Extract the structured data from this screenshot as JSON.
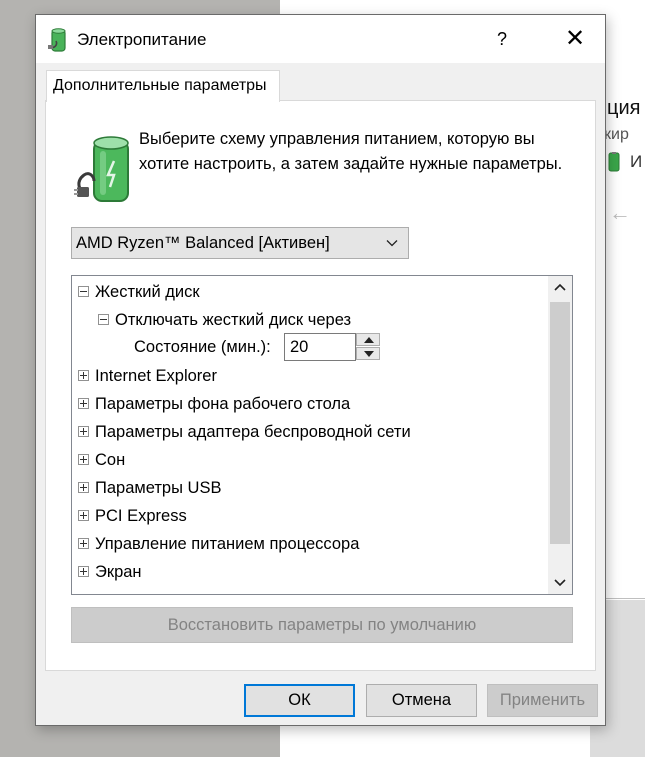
{
  "window": {
    "title": "Электропитание",
    "help_label": "?",
    "close_label": "✕"
  },
  "tab": {
    "label": "Дополнительные параметры"
  },
  "description": "Выберите схему управления питанием, которую вы хотите настроить, а затем задайте нужные параметры.",
  "plan_select": {
    "value": "AMD Ryzen™ Balanced [Активен]"
  },
  "tree": {
    "hard_disk": "Жесткий диск",
    "turn_off_disk": "Отключать жесткий диск через",
    "state_label": "Состояние (мин.):",
    "state_value": "20",
    "items": [
      "Internet Explorer",
      "Параметры фона рабочего стола",
      "Параметры адаптера беспроводной сети",
      "Сон",
      "Параметры USB",
      "PCI Express",
      "Управление питанием процессора",
      "Экран"
    ]
  },
  "restore_button": "Восстановить параметры по умолчанию",
  "buttons": {
    "ok": "ОК",
    "cancel": "Отмена",
    "apply": "Применить"
  },
  "background": {
    "text1": "ция",
    "text2": "кир",
    "text3": "И"
  },
  "colors": {
    "accent": "#0078d7",
    "dialog_bg": "#f0f0f0",
    "battery_green": "#3aa64a"
  }
}
